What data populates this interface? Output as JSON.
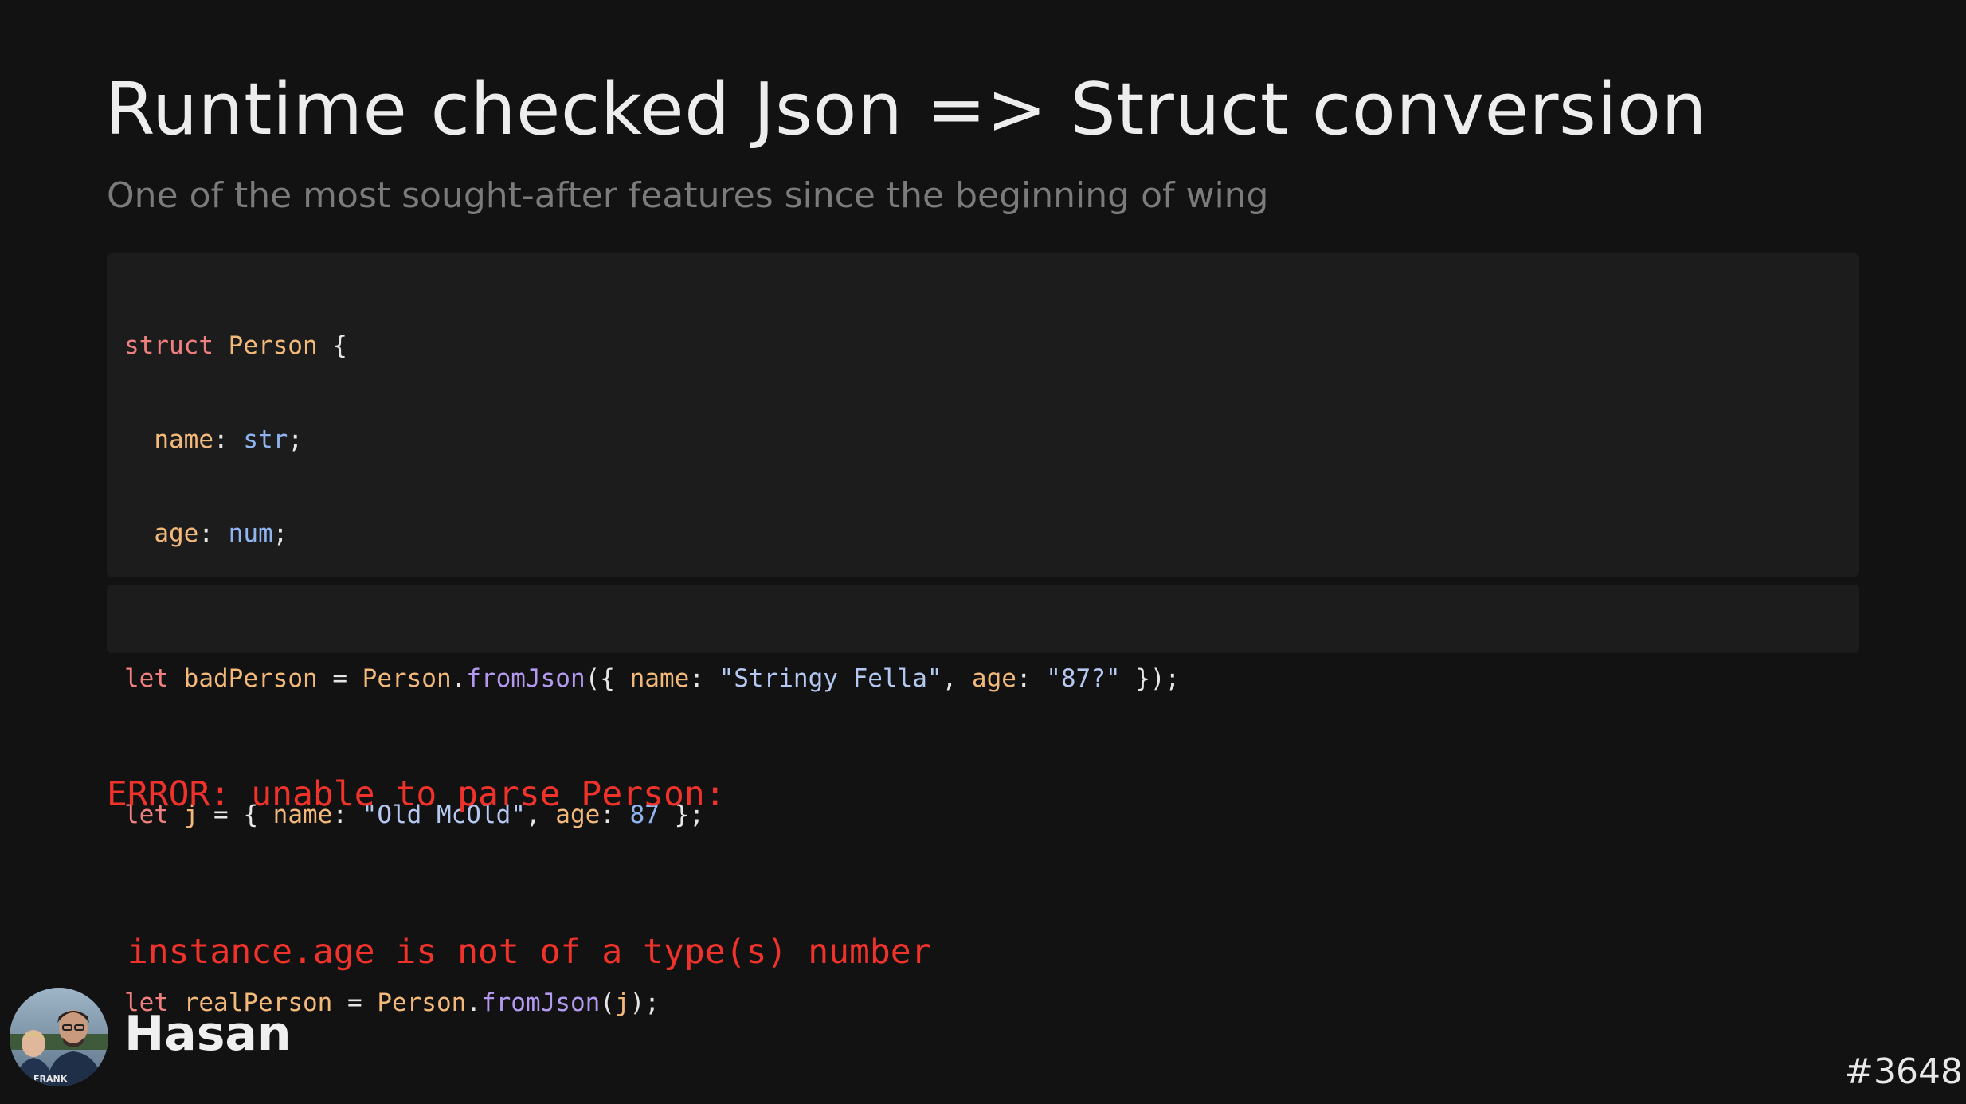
{
  "slide": {
    "title": "Runtime checked Json => Struct conversion",
    "subtitle": "One of the most sought-after features since the beginning of wing"
  },
  "code_block_1": {
    "l1": {
      "kw": "struct",
      "t1": " ",
      "name": "Person",
      "t2": " {"
    },
    "l2": {
      "indent": "  ",
      "field": "name",
      "sep": ": ",
      "type": "str",
      "end": ";"
    },
    "l3": {
      "indent": "  ",
      "field": "age",
      "sep": ": ",
      "type": "num",
      "end": ";"
    },
    "l4": {
      "text": "}"
    },
    "l6": {
      "kw": "let",
      "s1": " ",
      "var": "j",
      "s2": " = { ",
      "k1": "name",
      "s3": ": ",
      "v1": "\"Old McOld\"",
      "s4": ", ",
      "k2": "age",
      "s5": ": ",
      "v2": "87",
      "s6": " };"
    },
    "l8": {
      "kw": "let",
      "s1": " ",
      "var": "realPerson",
      "s2": " = ",
      "type": "Person",
      "s3": ".",
      "fn": "fromJson",
      "s4": "(",
      "arg": "j",
      "s5": ");"
    }
  },
  "code_block_2": {
    "kw": "let",
    "s1": " ",
    "var": "badPerson",
    "s2": " = ",
    "type": "Person",
    "s3": ".",
    "fn": "fromJson",
    "s4": "({ ",
    "k1": "name",
    "s5": ": ",
    "v1": "\"Stringy Fella\"",
    "s6": ", ",
    "k2": "age",
    "s7": ": ",
    "v2": "\"87?\"",
    "s8": " });"
  },
  "error": {
    "line1": "ERROR: unable to parse Person:",
    "line2": " instance.age is not of a type(s) number"
  },
  "presenter": {
    "name": "Hasan",
    "avatar_icon": "person-photo-avatar"
  },
  "slide_number": "#3648",
  "colors": {
    "background": "#121212",
    "code_background": "#1c1c1c",
    "keyword": "#f07f7f",
    "type": "#f2b97a",
    "builtin": "#8fb4f0",
    "string": "#b5c8f2",
    "function": "#b39af0",
    "error": "#f0332a"
  }
}
